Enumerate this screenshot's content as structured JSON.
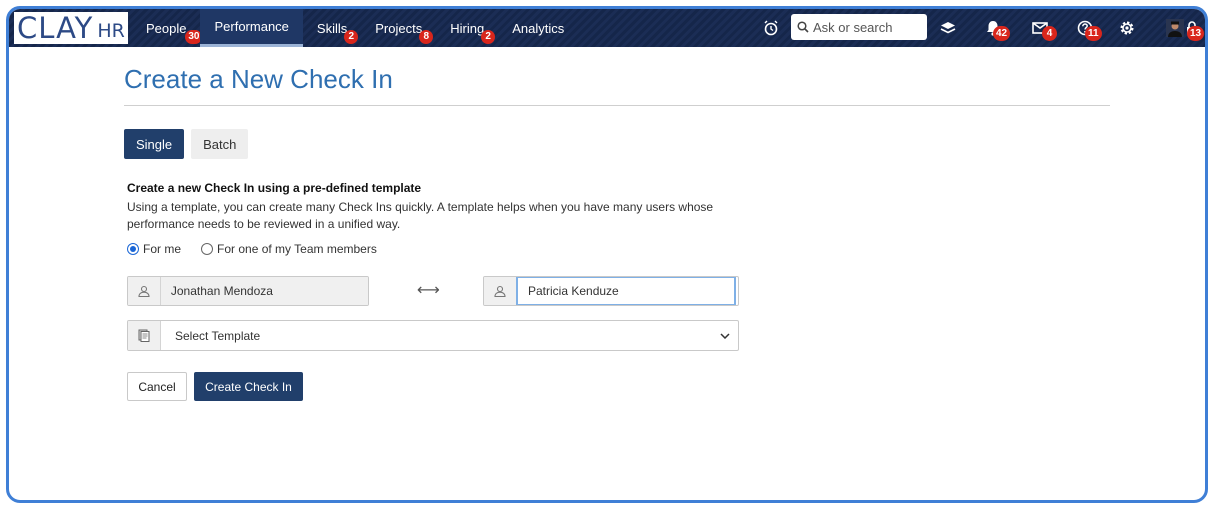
{
  "app": {
    "logo_main": "CLAY",
    "logo_sub": "HR"
  },
  "nav": {
    "items": [
      {
        "label": "People",
        "badge": "30",
        "active": false
      },
      {
        "label": "Performance",
        "badge": "",
        "active": true
      },
      {
        "label": "Skills",
        "badge": "2",
        "active": false
      },
      {
        "label": "Projects",
        "badge": "8",
        "active": false
      },
      {
        "label": "Hiring",
        "badge": "2",
        "active": false
      },
      {
        "label": "Analytics",
        "badge": "",
        "active": false
      }
    ]
  },
  "toolbar": {
    "search_placeholder": "Ask or search",
    "notifications_badge": "42",
    "messages_badge": "4",
    "help_badge": "11",
    "lock_badge": "13",
    "icons": [
      "alarm-clock-icon",
      "search-icon",
      "layers-icon",
      "bell-icon",
      "mail-icon",
      "help-icon",
      "gear-icon",
      "avatar",
      "lock-icon"
    ]
  },
  "page": {
    "title": "Create a New Check In",
    "tabs": {
      "single": "Single",
      "batch": "Batch",
      "active": "single"
    },
    "description_title": "Create a new Check In using a pre-defined template",
    "description_text": "Using a template, you can create many Check Ins quickly. A template helps when you have many users whose performance needs to be reviewed in a unified way.",
    "radio_options": {
      "for_me": "For me",
      "for_team": "For one of my Team members",
      "selected": "for_me"
    },
    "reviewer_name": "Jonathan Mendoza",
    "reviewee_name": "Patricia Kenduze",
    "swap_symbol": "⟷",
    "template_placeholder": "Select Template",
    "cancel_label": "Cancel",
    "create_label": "Create Check In"
  },
  "colors": {
    "navbar": "#15264a",
    "accent": "#213f6b",
    "title": "#2f6fb0",
    "badge": "#d9261c",
    "frame": "#3f7fd6"
  }
}
